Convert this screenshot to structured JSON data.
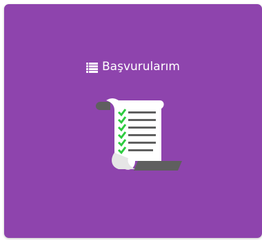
{
  "card": {
    "title": "Başvurularım",
    "icon": "list-icon",
    "illustration": "checklist-scroll-icon",
    "colors": {
      "background": "#8e44ad",
      "text": "#ffffff",
      "check": "#2ecc40",
      "scroll_paper": "#ffffff",
      "scroll_shade": "#5f5f5f"
    }
  }
}
